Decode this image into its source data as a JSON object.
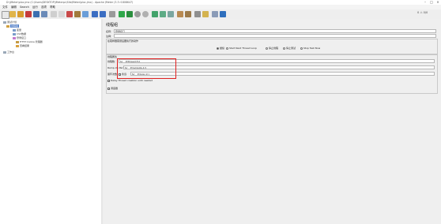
{
  "window": {
    "title": "D:\\JMeter\\ploc.jmx (C:\\Users\\DESKTOP\\JMeterpc\\SiteJMeter\\ploc.jmx) - Apache JMeter (3.3 r1808647)",
    "minimize": "–",
    "maximize": "□",
    "close": "×"
  },
  "menu": [
    "文件",
    "编辑",
    "Search",
    "运行",
    "选项",
    "帮助"
  ],
  "toolbar": {
    "counter": "0 ⚠ 0/0"
  },
  "tree": {
    "items": [
      {
        "label": "测试计划"
      },
      {
        "label": "线程组"
      },
      {
        "label": "变量"
      },
      {
        "label": "CSV数据"
      },
      {
        "label": "登录接口"
      },
      {
        "label": "HTTP Cookie 管理器"
      },
      {
        "label": "查看结果"
      },
      {
        "label": "工作台"
      }
    ]
  },
  "panel": {
    "title": "线程组",
    "name_label": "名称：",
    "name_value": "登录接口",
    "comment_label": "注释：",
    "error_action_label": "在取样器错误后要执行的动作",
    "actions": [
      "继续",
      "Start Next Thread Loop",
      "停止线程",
      "停止测试",
      "Stop Test Now"
    ],
    "thread_props_label": "线程属性",
    "threads_label": "线程数：",
    "threads_value": "${__P(thread,5)}",
    "rampup_label": "Ramp-Up Period (in seconds):",
    "rampup_value": "${__P(rampUp,1)}",
    "loop_label": "循环次数",
    "forever_label": "永远",
    "loop_value": "${__P(loop,1)}",
    "delay_label": "Delay Thread creation until needed",
    "scheduler_label": "调度器"
  }
}
